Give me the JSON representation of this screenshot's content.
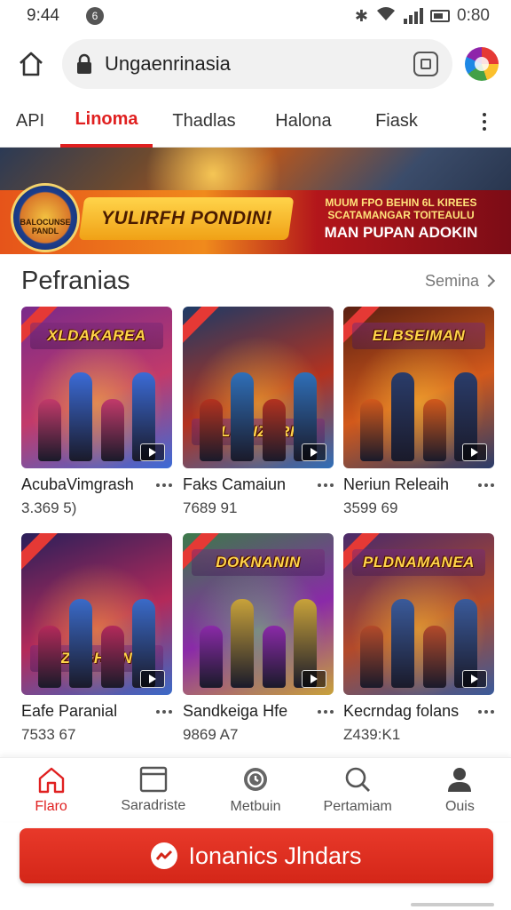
{
  "status_bar": {
    "time": "9:44",
    "notif": "6",
    "battery_text": "0:80"
  },
  "browser": {
    "url": "Ungaenrinasia"
  },
  "tabs": [
    "API",
    "Linoma",
    "Thadlas",
    "Halona",
    "Fiask"
  ],
  "active_tab": "Linoma",
  "banner": {
    "badge": "BALOCUNSE PANDL",
    "headline": "YULIRFH PONDIN!",
    "promo_line1": "MUUM FPO BEHIN 6L KIREES",
    "promo_line2": "SCATAMANGAR TOITEAULU",
    "promo_line3": "MAN PUPAN ADOKIN"
  },
  "section": {
    "title": "Pefranias",
    "see_more": "Semina"
  },
  "games": [
    {
      "name": "AcubaVimgrash",
      "count": "3.369 5)",
      "art": "XLDAKAREA",
      "art_pos": "top",
      "colors": [
        "#7a2a8a",
        "#c23a6a",
        "#3b6bd6",
        "#ffcf3a"
      ]
    },
    {
      "name": "Faks Camaiun",
      "count": "7689 91",
      "art": "ELRAIZARIN",
      "art_pos": "bottom",
      "colors": [
        "#1d3a66",
        "#b3321f",
        "#2f6fb8",
        "#ffcf3a"
      ]
    },
    {
      "name": "Neriun Releaih",
      "count": "3599 69",
      "art": "ELBSEIMAN",
      "art_pos": "top",
      "colors": [
        "#5a1f12",
        "#d2591b",
        "#2a3c6a",
        "#ffcf3a"
      ]
    },
    {
      "name": "Eafe Paranial",
      "count": "7533 67",
      "art": "ZAGHIAN",
      "art_pos": "bottom",
      "colors": [
        "#2a1f5a",
        "#b32a5a",
        "#3a6ac8",
        "#ffb03a"
      ]
    },
    {
      "name": "Sandkeiga Hfe",
      "count": "9869 A7",
      "art": "DOKNANIN",
      "art_pos": "top",
      "colors": [
        "#3c7a4a",
        "#8a2aa8",
        "#c8a23a",
        "#6adf6a"
      ]
    },
    {
      "name": "Kecrndag folans",
      "count": "Z439:K1",
      "art": "PLDNAMANEA",
      "art_pos": "top",
      "colors": [
        "#4a2a6a",
        "#b34a2a",
        "#3a5a9a",
        "#ffcf3a"
      ]
    }
  ],
  "bottom_nav": [
    {
      "label": "Flaro",
      "icon": "home-icon"
    },
    {
      "label": "Saradriste",
      "icon": "window-icon"
    },
    {
      "label": "Metbuin",
      "icon": "clock-icon"
    },
    {
      "label": "Pertamiam",
      "icon": "search-icon"
    },
    {
      "label": "Ouis",
      "icon": "person-icon"
    }
  ],
  "active_nav": "Flaro",
  "cta": {
    "label": "Ionanics Jlndars"
  },
  "colors": {
    "accent": "#e02020",
    "cta": "#d42618"
  }
}
